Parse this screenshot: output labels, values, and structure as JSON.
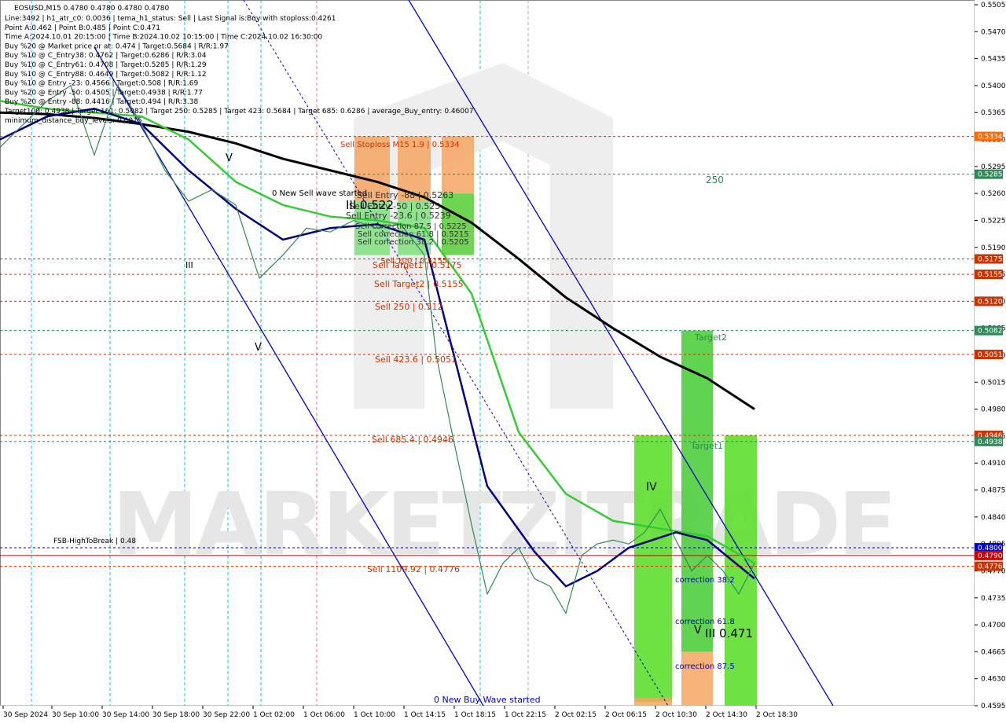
{
  "chart_data": {
    "type": "candlestick",
    "symbol_header": "EOSUSD,M15  0.4780 0.4780 0.4780 0.4780",
    "info_lines": [
      "Line:3492 | h1_atr_c0: 0.0036 | tema_h1_status: Sell | Last Signal is:Buy with stoploss:0.4261",
      "Point A:0.462 | Point B:0.485 | Point C:0.471",
      "Time A:2024.10.01 20:15:00 | Time B:2024.10.02 10:15:00 | Time C:2024.10.02 16:30:00",
      "Buy %20 @ Market price or at: 0.474 | Target:0.5684 | R/R:1.97",
      "Buy %10 @ C_Entry38: 0.4762 | Target:0.6286 | R/R:3.04",
      "Buy %10 @ C_Entry61: 0.4708 | Target:0.5285 | R/R:1.29",
      "Buy %10 @ C_Entry88: 0.4649 | Target:0.5082 | R/R:1.12",
      "Buy %10 @ Entry -23: 0.4566 | Target:0.508 | R/R:1.69",
      "Buy %20 @ Entry -50: 0.4505 | Target:0.4938 | R/R:1.77",
      "Buy %20 @ Entry -88: 0.4416 | Target:0.494 | R/R:3.38",
      "Target100: 0.4938 | Target 161: 0.5082 | Target 250: 0.5285 | Target 423: 0.5684 | Target 685: 0.6286 | average_Buy_entry: 0.46007",
      "minimum_distance_buy_levels: 0.0015"
    ],
    "ylim": [
      0.4595,
      0.5505
    ],
    "y_ticks": [
      "0.5505",
      "0.5470",
      "0.5435",
      "0.5400",
      "0.5365",
      "0.5330",
      "0.5295",
      "0.5260",
      "0.5225",
      "0.5190",
      "0.5155",
      "0.5120",
      "0.5085",
      "0.5050",
      "0.5015",
      "0.4980",
      "0.4945",
      "0.4910",
      "0.4875",
      "0.4840",
      "0.4805",
      "0.4770",
      "0.4735",
      "0.4700",
      "0.4665",
      "0.4630",
      "0.4595"
    ],
    "x_ticks": [
      "30 Sep 2024",
      "30 Sep 10:00",
      "30 Sep 14:00",
      "30 Sep 18:00",
      "30 Sep 22:00",
      "1 Oct 02:00",
      "1 Oct 06:00",
      "1 Oct 10:00",
      "1 Oct 14:15",
      "1 Oct 18:15",
      "1 Oct 22:15",
      "2 Oct 02:15",
      "2 Oct 06:15",
      "2 Oct 10:30",
      "2 Oct 14:30",
      "2 Oct 18:30"
    ],
    "price_levels": [
      {
        "value": 0.5334,
        "label": "0.5334",
        "color": "#ff6a00",
        "line": "#cc3300"
      },
      {
        "value": 0.5285,
        "label": "0.5285",
        "color": "#2e8b57",
        "line": "#2e8b57"
      },
      {
        "value": 0.5175,
        "label": "0.5175",
        "color": "#cc3300",
        "line": "#cc3300"
      },
      {
        "value": 0.5155,
        "label": "0.5155",
        "color": "#cc3300",
        "line": "#cc3300"
      },
      {
        "value": 0.512,
        "label": "0.5120",
        "color": "#cc3300",
        "line": "#cc3300"
      },
      {
        "value": 0.5082,
        "label": "0.5082",
        "color": "#2e8b57",
        "line": "#2e8b57"
      },
      {
        "value": 0.5051,
        "label": "0.5051",
        "color": "#cc3300",
        "line": "#cc3300"
      },
      {
        "value": 0.4946,
        "label": "0.4946",
        "color": "#cc3300",
        "line": "#cc3300"
      },
      {
        "value": 0.4938,
        "label": "0.4938",
        "color": "#2e8b57",
        "line": "#2e8b57"
      },
      {
        "value": 0.48,
        "label": "0.4800",
        "color": "#0000cc",
        "line": "#0000cc"
      },
      {
        "value": 0.479,
        "label": "0.4790",
        "color": "#cc0000",
        "line": "#cc0000"
      },
      {
        "value": 0.4776,
        "label": "0.4776",
        "color": "#cc3300",
        "line": "#cc3300"
      }
    ],
    "annotations": [
      {
        "text": "Sell Stoploss M15 1.9 | 0.5334",
        "color": "#cc3300"
      },
      {
        "text": "250",
        "color": "#2e8b57"
      },
      {
        "text": "0 New Sell wave started",
        "color": "#000000"
      },
      {
        "text": "Sell Entry -88 | 0.5263",
        "color": "#333333"
      },
      {
        "text": "Sell Entry -50 | 0.525",
        "color": "#333333"
      },
      {
        "text": "Sell Entry -23.6 | 0.5239",
        "color": "#333333"
      },
      {
        "text": "Sell correction 87.5 | 0.5225",
        "color": "#333333"
      },
      {
        "text": "Sell correction 61.8 | 0.5215",
        "color": "#333333"
      },
      {
        "text": "Sell correction 38.2 | 0.5205",
        "color": "#333333"
      },
      {
        "text": "Sell Target1 | 0.5175",
        "color": "#cc3300"
      },
      {
        "text": "Sell Target2 | 0.5155",
        "color": "#cc3300"
      },
      {
        "text": "Sell 100 | 0.5155",
        "color": "#cc3300"
      },
      {
        "text": "Sell 250 | 0.512",
        "color": "#cc3300"
      },
      {
        "text": "Sell 423.6 | 0.5051",
        "color": "#cc3300"
      },
      {
        "text": "Sell 685.4 | 0.4946",
        "color": "#cc3300"
      },
      {
        "text": "Sell 1109.92 | 0.4776",
        "color": "#cc3300"
      },
      {
        "text": "Target2",
        "color": "#2e8b57"
      },
      {
        "text": "Target1",
        "color": "#2e8b57"
      },
      {
        "text": "IV",
        "color": "#000000"
      },
      {
        "text": "correction 38.2",
        "color": "#0000cc"
      },
      {
        "text": "correction 61.8",
        "color": "#0000cc"
      },
      {
        "text": "correction 87.5",
        "color": "#0000cc"
      },
      {
        "text": "V",
        "color": "#000000"
      },
      {
        "text": "III 0.471",
        "color": "#000000"
      },
      {
        "text": "III 0.522",
        "color": "#000000"
      },
      {
        "text": "0 New Buy Wave started",
        "color": "#0000cc"
      },
      {
        "text": "FSB-HighToBreak | 0.48",
        "color": "#000000"
      },
      {
        "text": "V",
        "color": "#000000"
      },
      {
        "text": "III",
        "color": "#000000"
      },
      {
        "text": "V",
        "color": "#000000"
      }
    ],
    "watermark": "MARKETZITRADE",
    "series": [
      {
        "name": "black_ma",
        "color": "#000000",
        "values": [
          [
            0,
            0.5365
          ],
          [
            60,
            0.5363
          ],
          [
            120,
            0.5358
          ],
          [
            180,
            0.535
          ],
          [
            240,
            0.534
          ],
          [
            300,
            0.5325
          ],
          [
            360,
            0.5305
          ],
          [
            420,
            0.529
          ],
          [
            480,
            0.5275
          ],
          [
            540,
            0.5255
          ],
          [
            600,
            0.5222
          ],
          [
            660,
            0.5175
          ],
          [
            720,
            0.5125
          ],
          [
            780,
            0.5085
          ],
          [
            840,
            0.5048
          ],
          [
            900,
            0.502
          ],
          [
            960,
            0.498
          ]
        ]
      },
      {
        "name": "green_ma",
        "color": "#33cc33",
        "values": [
          [
            0,
            0.538
          ],
          [
            60,
            0.537
          ],
          [
            120,
            0.5365
          ],
          [
            180,
            0.536
          ],
          [
            240,
            0.533
          ],
          [
            300,
            0.5275
          ],
          [
            360,
            0.5245
          ],
          [
            420,
            0.523
          ],
          [
            480,
            0.5225
          ],
          [
            540,
            0.5215
          ],
          [
            600,
            0.513
          ],
          [
            660,
            0.495
          ],
          [
            720,
            0.487
          ],
          [
            780,
            0.4835
          ],
          [
            840,
            0.4825
          ],
          [
            900,
            0.4815
          ],
          [
            960,
            0.478
          ]
        ]
      },
      {
        "name": "navy_ma",
        "color": "#000080",
        "values": [
          [
            0,
            0.533
          ],
          [
            60,
            0.536
          ],
          [
            120,
            0.537
          ],
          [
            180,
            0.535
          ],
          [
            240,
            0.529
          ],
          [
            300,
            0.524
          ],
          [
            360,
            0.52
          ],
          [
            420,
            0.5215
          ],
          [
            480,
            0.522
          ],
          [
            540,
            0.52
          ],
          [
            580,
            0.504
          ],
          [
            620,
            0.488
          ],
          [
            680,
            0.4795
          ],
          [
            720,
            0.475
          ],
          [
            760,
            0.477
          ],
          [
            800,
            0.48
          ],
          [
            860,
            0.482
          ],
          [
            900,
            0.481
          ],
          [
            960,
            0.476
          ]
        ]
      },
      {
        "name": "price",
        "color": "#2e8b57",
        "values": [
          [
            0,
            0.532
          ],
          [
            30,
            0.535
          ],
          [
            60,
            0.538
          ],
          [
            90,
            0.54
          ],
          [
            120,
            0.531
          ],
          [
            150,
            0.54
          ],
          [
            180,
            0.535
          ],
          [
            210,
            0.529
          ],
          [
            240,
            0.525
          ],
          [
            270,
            0.5265
          ],
          [
            300,
            0.5245
          ],
          [
            330,
            0.515
          ],
          [
            360,
            0.518
          ],
          [
            390,
            0.5215
          ],
          [
            420,
            0.521
          ],
          [
            450,
            0.5225
          ],
          [
            480,
            0.5215
          ],
          [
            510,
            0.522
          ],
          [
            540,
            0.518
          ],
          [
            555,
            0.505
          ],
          [
            575,
            0.495
          ],
          [
            600,
            0.483
          ],
          [
            620,
            0.474
          ],
          [
            640,
            0.478
          ],
          [
            660,
            0.48
          ],
          [
            680,
            0.476
          ],
          [
            700,
            0.475
          ],
          [
            720,
            0.4715
          ],
          [
            740,
            0.479
          ],
          [
            760,
            0.4805
          ],
          [
            780,
            0.481
          ],
          [
            800,
            0.4805
          ],
          [
            820,
            0.482
          ],
          [
            840,
            0.485
          ],
          [
            860,
            0.481
          ],
          [
            880,
            0.477
          ],
          [
            900,
            0.479
          ],
          [
            920,
            0.477
          ],
          [
            940,
            0.474
          ],
          [
            960,
            0.478
          ]
        ]
      }
    ]
  }
}
